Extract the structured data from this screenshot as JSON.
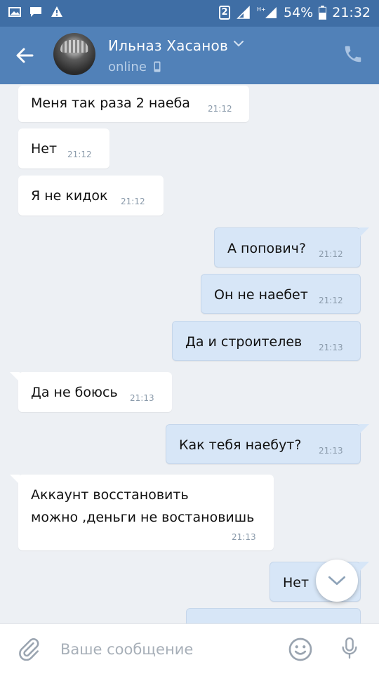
{
  "status_bar": {
    "sim": "2",
    "battery": "54%",
    "time": "21:32"
  },
  "header": {
    "contact_name": "Ильназ Хасанов",
    "status": "online"
  },
  "messages": [
    {
      "text": "Меня так раза 2 наеба",
      "time": "21:12",
      "dir": "in"
    },
    {
      "text": "Нет",
      "time": "21:12",
      "dir": "in"
    },
    {
      "text": "Я не кидок",
      "time": "21:12",
      "dir": "in"
    },
    {
      "text": "А попович?",
      "time": "21:12",
      "dir": "out"
    },
    {
      "text": "Он не наебет",
      "time": "21:12",
      "dir": "out"
    },
    {
      "text": "Да и строителев",
      "time": "21:13",
      "dir": "out"
    },
    {
      "text": "Да не боюсь",
      "time": "21:13",
      "dir": "in"
    },
    {
      "text": "Как тебя наебут?",
      "time": "21:13",
      "dir": "out"
    },
    {
      "line1": "Аккаунт восстановить",
      "line2": "можно ,деньги не востановишь",
      "time": "21:13",
      "dir": "in"
    },
    {
      "text": "Нет",
      "time": "",
      "dir": "out"
    }
  ],
  "composer": {
    "placeholder": "Ваше сообщение"
  },
  "colors": {
    "header": "#5181b8",
    "statusbar": "#3f6ea5",
    "bg": "#edf0f4",
    "outgoing": "#d7e6f7"
  },
  "icons": [
    "gallery-icon",
    "chat-icon",
    "warning-icon",
    "signal-icon",
    "battery-icon",
    "back-arrow-icon",
    "chevron-down-icon",
    "phone-small-icon",
    "call-icon",
    "scroll-down-icon",
    "attach-icon",
    "emoji-icon",
    "mic-icon"
  ]
}
